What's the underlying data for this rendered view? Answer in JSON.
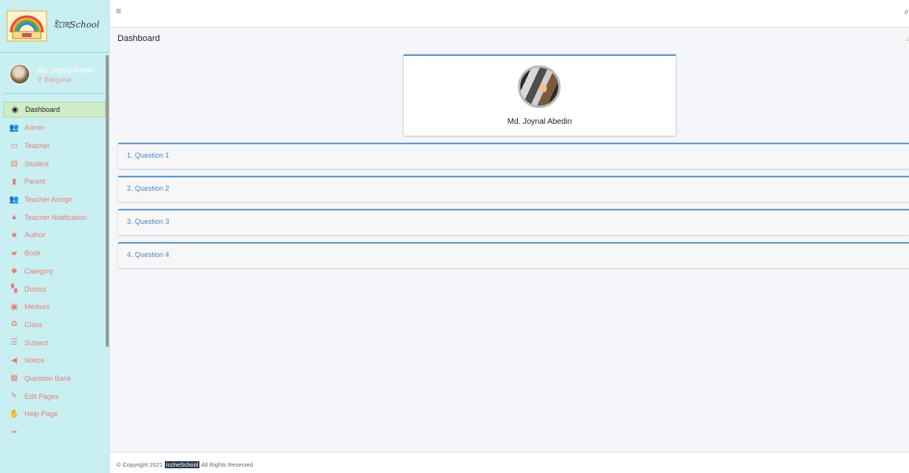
{
  "sidebar": {
    "brand_text": "ইচ্ছেSchool",
    "user": {
      "name": "Md. Joynal Abedin",
      "location": "Barguna"
    },
    "items": [
      {
        "label": "Dashboard",
        "icon": "tachometer-icon",
        "active": true
      },
      {
        "label": "Admin",
        "icon": "users-icon"
      },
      {
        "label": "Teacher",
        "icon": "chalkboard-teacher-icon"
      },
      {
        "label": "Student",
        "icon": "id-card-icon"
      },
      {
        "label": "Parent",
        "icon": "id-badge-icon"
      },
      {
        "label": "Teacher Assign",
        "icon": "users-icon"
      },
      {
        "label": "Teacher Notification",
        "icon": "bell-icon"
      },
      {
        "label": "Author",
        "icon": "user-tie-icon"
      },
      {
        "label": "Book",
        "icon": "book-icon"
      },
      {
        "label": "Category",
        "icon": "tags-icon"
      },
      {
        "label": "District",
        "icon": "map-icon"
      },
      {
        "label": "Medium",
        "icon": "language-icon"
      },
      {
        "label": "Class",
        "icon": "recycle-icon"
      },
      {
        "label": "Subject",
        "icon": "list-icon"
      },
      {
        "label": "Notice",
        "icon": "bullhorn-icon"
      },
      {
        "label": "Question Bank",
        "icon": "archive-icon"
      },
      {
        "label": "Edit Pages",
        "icon": "edit-icon"
      },
      {
        "label": "Help Page",
        "icon": "hands-helping-icon"
      }
    ]
  },
  "topbar": {
    "menu_icon": "bars-icon"
  },
  "page": {
    "title": "Dashboard"
  },
  "profile": {
    "name": "Md. Joynal Abedin"
  },
  "questions": [
    "1. Question 1",
    "2. Question 2",
    "3. Question 3",
    "4. Question 4"
  ],
  "footer": {
    "prefix": "© Copyright 2021",
    "brand": "IccheSchool",
    "suffix": "All Rights Reserved"
  },
  "colors": {
    "sidebar_bg": "#c8f0f3",
    "accent_blue": "#5b9bd5",
    "menu_text": "#ee7d73",
    "active_bg": "#d1ebc8"
  }
}
